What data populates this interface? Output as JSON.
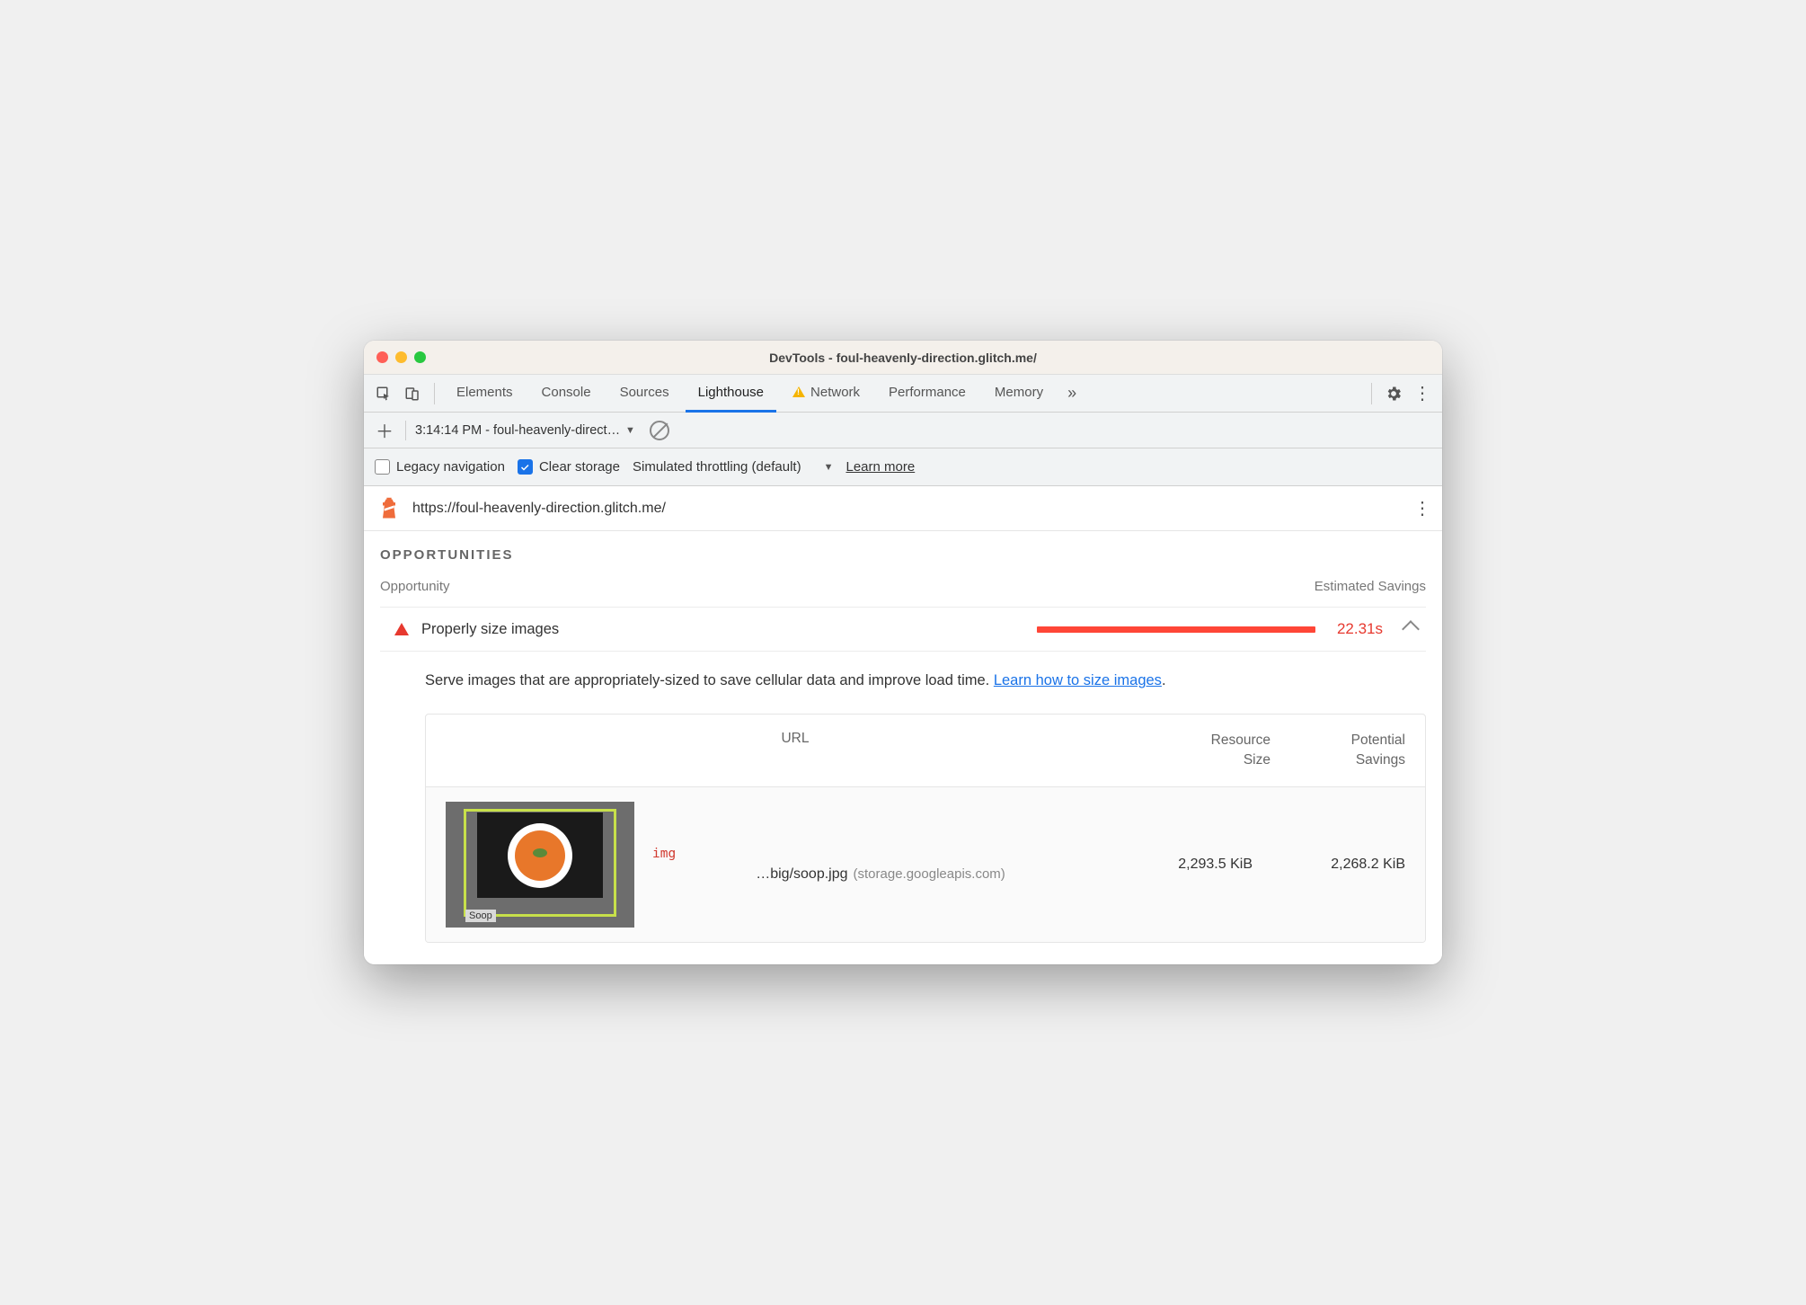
{
  "window_title": "DevTools - foul-heavenly-direction.glitch.me/",
  "tabs": {
    "elements": "Elements",
    "console": "Console",
    "sources": "Sources",
    "lighthouse": "Lighthouse",
    "network": "Network",
    "performance": "Performance",
    "memory": "Memory"
  },
  "subbar": {
    "report_selector": "3:14:14 PM - foul-heavenly-direction.glitch.me"
  },
  "options": {
    "legacy": "Legacy navigation",
    "clear": "Clear storage",
    "throttling": "Simulated throttling (default)",
    "learn": "Learn more"
  },
  "page_url": "https://foul-heavenly-direction.glitch.me/",
  "section": "OPPORTUNITIES",
  "colhead_left": "Opportunity",
  "colhead_right": "Estimated Savings",
  "opportunity": {
    "label": "Properly size images",
    "value": "22.31s"
  },
  "description_text": "Serve images that are appropriately-sized to save cellular data and improve load time. ",
  "description_link": "Learn how to size images",
  "description_period": ".",
  "table": {
    "head_url": "URL",
    "head_size_l1": "Resource",
    "head_size_l2": "Size",
    "head_save_l1": "Potential",
    "head_save_l2": "Savings",
    "row": {
      "element_type": "img",
      "path": "…big/soop.jpg",
      "host": "(storage.googleapis.com)",
      "size": "2,293.5 KiB",
      "savings": "2,268.2 KiB",
      "thumb_caption": "Soop"
    }
  }
}
